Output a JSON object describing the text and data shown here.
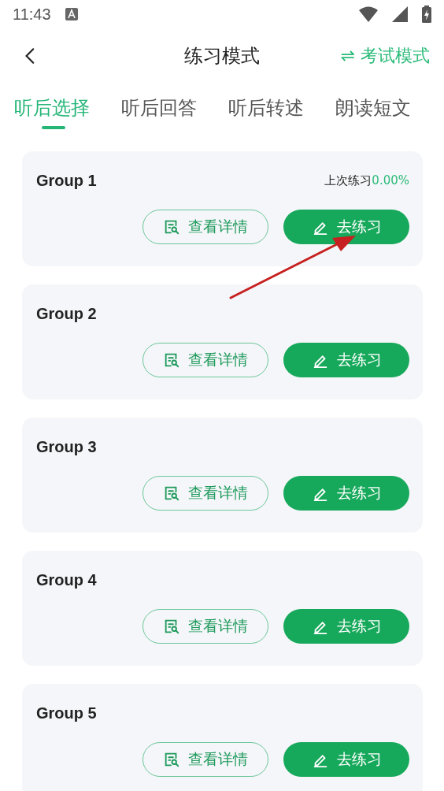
{
  "status_bar": {
    "time": "11:43"
  },
  "header": {
    "title": "练习模式",
    "switch_label": "考试模式",
    "switch_icon": "⇌"
  },
  "tabs": [
    {
      "label": "听后选择",
      "selected": true
    },
    {
      "label": "听后回答",
      "selected": false
    },
    {
      "label": "听后转述",
      "selected": false
    },
    {
      "label": "朗读短文",
      "selected": false
    }
  ],
  "groups": [
    {
      "title": "Group 1",
      "last_label": "上次练习",
      "last_value": "0.00%",
      "details_button": "查看详情",
      "practice_button": "去练习"
    },
    {
      "title": "Group 2",
      "details_button": "查看详情",
      "practice_button": "去练习"
    },
    {
      "title": "Group 3",
      "details_button": "查看详情",
      "practice_button": "去练习"
    },
    {
      "title": "Group 4",
      "details_button": "查看详情",
      "practice_button": "去练习"
    },
    {
      "title": "Group 5",
      "details_button": "查看详情",
      "practice_button": "去练习"
    }
  ]
}
